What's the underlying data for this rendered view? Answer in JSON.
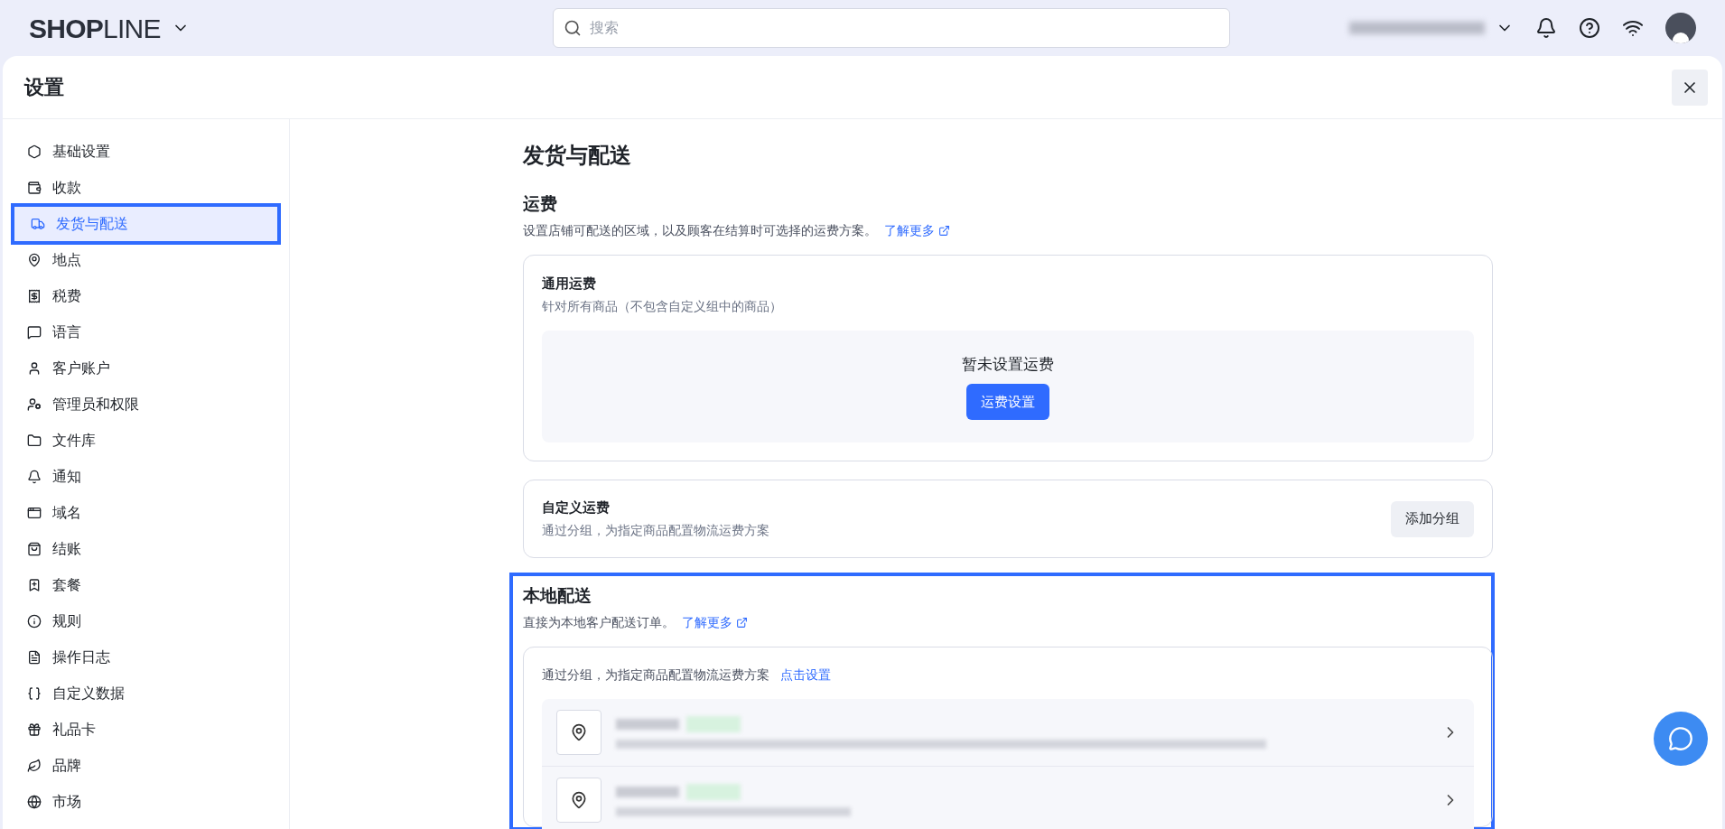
{
  "header": {
    "logo": "**SHOP**LINE",
    "search": {
      "placeholder": "搜索"
    }
  },
  "panel": {
    "title": "设置"
  },
  "sidebar": {
    "items": [
      {
        "label": "基础设置",
        "selected": false
      },
      {
        "label": "收款",
        "selected": false
      },
      {
        "label": "发货与配送",
        "selected": true
      },
      {
        "label": "地点",
        "selected": false
      },
      {
        "label": "税费",
        "selected": false
      },
      {
        "label": "语言",
        "selected": false
      },
      {
        "label": "客户账户",
        "selected": false
      },
      {
        "label": "管理员和权限",
        "selected": false
      },
      {
        "label": "文件库",
        "selected": false
      },
      {
        "label": "通知",
        "selected": false
      },
      {
        "label": "域名",
        "selected": false
      },
      {
        "label": "结账",
        "selected": false
      },
      {
        "label": "套餐",
        "selected": false
      },
      {
        "label": "规则",
        "selected": false
      },
      {
        "label": "操作日志",
        "selected": false
      },
      {
        "label": "自定义数据",
        "selected": false
      },
      {
        "label": "礼品卡",
        "selected": false
      },
      {
        "label": "品牌",
        "selected": false
      },
      {
        "label": "市场",
        "selected": false
      }
    ]
  },
  "page": {
    "title": "发货与配送",
    "shipping": {
      "title": "运费",
      "description": "设置店铺可配送的区域，以及顾客在结算时可选择的运费方案。",
      "link": "了解更多",
      "general": {
        "title": "通用运费",
        "subtitle": "针对所有商品（不包含自定义组中的商品）",
        "empty": "暂未设置运费",
        "button": "运费设置"
      },
      "custom": {
        "title": "自定义运费",
        "subtitle": "通过分组，为指定商品配置物流运费方案",
        "button": "添加分组"
      }
    },
    "local": {
      "title": "本地配送",
      "description": "直接为本地客户配送订单。",
      "link": "了解更多",
      "highlighted": true,
      "card": {
        "text": "通过分组，为指定商品配置物流运费方案",
        "link": "点击设置",
        "rows": [
          {
            "kind": "location"
          },
          {
            "kind": "location"
          }
        ]
      }
    }
  }
}
